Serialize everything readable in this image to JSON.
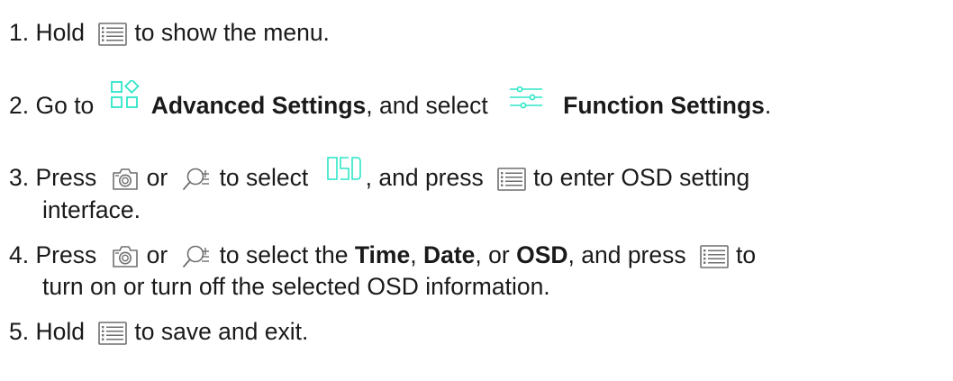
{
  "colors": {
    "text": "#1a1a1a",
    "icon_gray": "#6f6f6f",
    "accent": "#2ee6c8"
  },
  "icons": {
    "menu": "menu-list-icon",
    "camera": "camera-icon",
    "zoom": "zoom-icon",
    "advanced": "advanced-settings-icon",
    "function": "function-settings-sliders-icon",
    "osd": "osd-icon"
  },
  "steps": [
    {
      "number": "1.",
      "t1": "Hold",
      "t2": "to show the menu."
    },
    {
      "number": "2.",
      "t1": "Go to",
      "bold1": "Advanced Settings",
      "t2": ", and select",
      "bold2": "Function Settings",
      "t3": "."
    },
    {
      "number": "3.",
      "t1": "Press",
      "t2": "or",
      "t3": "to select",
      "t4": ", and press",
      "t5": "to enter OSD setting",
      "t6": "interface."
    },
    {
      "number": "4.",
      "t1": "Press",
      "t2": "or",
      "t3": "to select the",
      "bold1": "Time",
      "t4": ",",
      "bold2": "Date",
      "t5": ", or",
      "bold3": "OSD",
      "t6": ", and press",
      "t7": "to",
      "t8": "turn on or turn off the selected OSD information."
    },
    {
      "number": "5.",
      "t1": "Hold",
      "t2": "to save and exit."
    }
  ]
}
